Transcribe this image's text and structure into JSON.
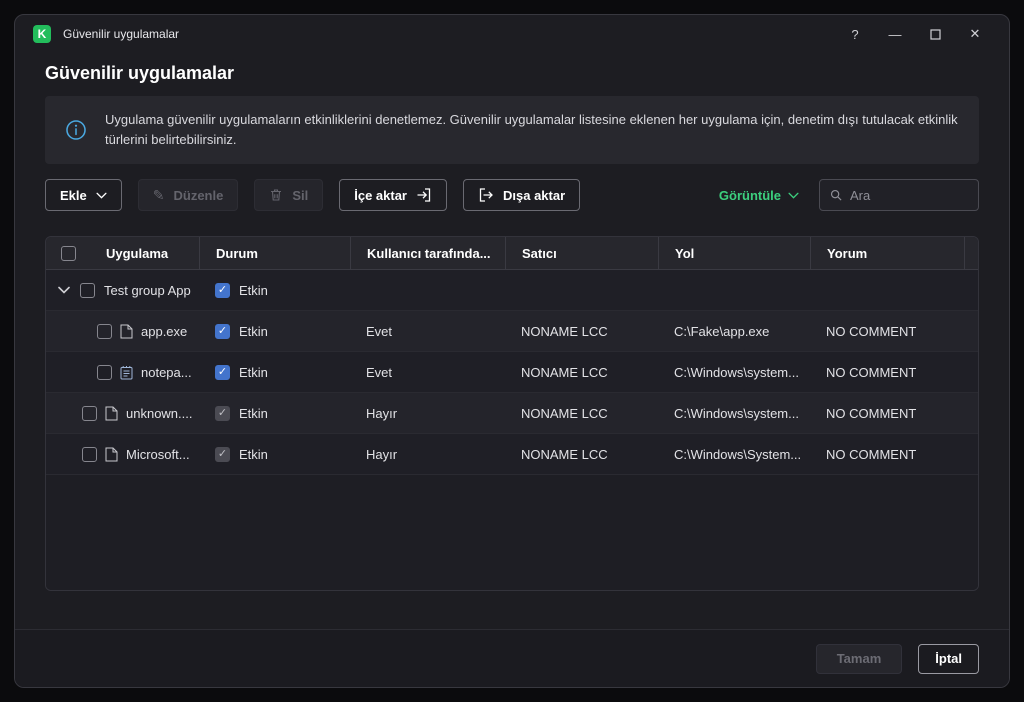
{
  "colors": {
    "brand_green": "#23bd5c",
    "accent_green": "#3ccf7e",
    "checkbox_checked": "#4374cc",
    "info_blue": "#4aa8e0"
  },
  "window": {
    "titlebar": {
      "logo_glyph": "K",
      "title": "Güvenilir uygulamalar",
      "help": "?",
      "minimize": "—",
      "close": "✕"
    },
    "page_title": "Güvenilir uygulamalar"
  },
  "info_banner": {
    "text": "Uygulama güvenilir uygulamaların etkinliklerini denetlemez. Güvenilir uygulamalar listesine eklenen her uygulama için, denetim dışı tutulacak etkinlik türlerini belirtebilirsiniz."
  },
  "toolbar": {
    "add_label": "Ekle",
    "edit_label": "Düzenle",
    "delete_label": "Sil",
    "import_label": "İçe aktar",
    "export_label": "Dışa aktar",
    "view_label": "Görüntüle",
    "search_placeholder": "Ara"
  },
  "table": {
    "headers": [
      "Uygulama",
      "Durum",
      "Kullanıcı tarafında...",
      "Satıcı",
      "Yol",
      "Yorum"
    ],
    "rows": [
      {
        "name": "Test group App",
        "status": "Etkin",
        "enabled": true,
        "user": "",
        "vendor": "",
        "path": "",
        "comment": ""
      },
      {
        "name": "app.exe",
        "status": "Etkin",
        "enabled": true,
        "user": "Evet",
        "vendor": "NONAME LCC",
        "path": "C:\\Fake\\app.exe",
        "comment": "NO COMMENT"
      },
      {
        "name": "notepa...",
        "status": "Etkin",
        "enabled": true,
        "user": "Evet",
        "vendor": "NONAME LCC",
        "path": "C:\\Windows\\system...",
        "comment": "NO COMMENT"
      },
      {
        "name": "unknown....",
        "status": "Etkin",
        "enabled": false,
        "user": "Hayır",
        "vendor": "NONAME LCC",
        "path": "C:\\Windows\\system...",
        "comment": "NO COMMENT"
      },
      {
        "name": "Microsoft...",
        "status": "Etkin",
        "enabled": false,
        "user": "Hayır",
        "vendor": "NONAME LCC",
        "path": "C:\\Windows\\System...",
        "comment": "NO COMMENT"
      }
    ]
  },
  "footer": {
    "ok_label": "Tamam",
    "cancel_label": "İptal"
  }
}
